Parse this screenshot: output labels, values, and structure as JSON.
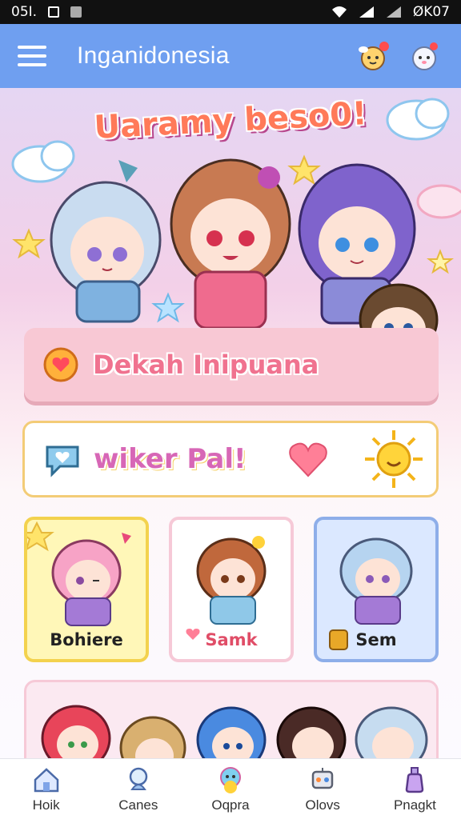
{
  "status_bar": {
    "time": "05I.",
    "right_text": "ØK07"
  },
  "app_bar": {
    "title": "Inganidonesia"
  },
  "hero": {
    "title": "Uaramy beso0!"
  },
  "banner_primary": {
    "label": "Dekah Inipuana"
  },
  "banner_secondary": {
    "label": "wiker Pal!"
  },
  "cards": [
    {
      "label": "Bohiere",
      "color": "#f3d24e"
    },
    {
      "label": "Samk",
      "color": "#f6c9d7"
    },
    {
      "label": "Sem",
      "color": "#8eaee9"
    }
  ],
  "bottom_nav": [
    {
      "label": "Hoik",
      "icon": "home-icon"
    },
    {
      "label": "Canes",
      "icon": "game-icon"
    },
    {
      "label": "Oqpra",
      "icon": "character-icon"
    },
    {
      "label": "Olovs",
      "icon": "robot-icon"
    },
    {
      "label": "Pnagkt",
      "icon": "potion-icon"
    }
  ],
  "colors": {
    "app_bar": "#6f9ff0",
    "accent_pink": "#f0728f",
    "accent_yellow": "#f3d24e"
  }
}
